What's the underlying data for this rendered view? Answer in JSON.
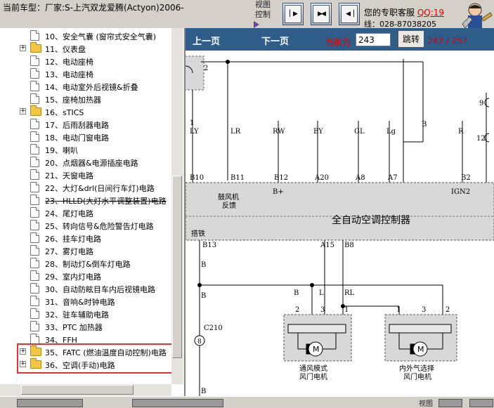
{
  "window": {
    "title": "当前车型：厂家:S-上汽双龙爱腾(Actyon)2006-",
    "view_label": "视图控制",
    "support_text": "您的专职客服",
    "support_qq": "QQ:19",
    "support_line": "线：028-87038205"
  },
  "tree": {
    "items": [
      {
        "label": "10、安全气囊 (窗帘式安全气囊)",
        "type": "doc"
      },
      {
        "label": "11、仪表盘",
        "type": "folder",
        "expandable": true
      },
      {
        "label": "12、电动座椅",
        "type": "doc"
      },
      {
        "label": "13、电动座椅",
        "type": "doc"
      },
      {
        "label": "14、电动室外后视镜&折叠",
        "type": "doc"
      },
      {
        "label": "15、座椅加热器",
        "type": "doc"
      },
      {
        "label": "16、sTICS",
        "type": "folder",
        "expandable": true
      },
      {
        "label": "17、后雨刮器电路",
        "type": "doc"
      },
      {
        "label": "18、电动门窗电路",
        "type": "doc"
      },
      {
        "label": "19、喇叭",
        "type": "doc"
      },
      {
        "label": "20、点烟器&电源插座电路",
        "type": "doc"
      },
      {
        "label": "21、天窗电路",
        "type": "doc"
      },
      {
        "label": "22、大灯&drl(日间行车灯)电路",
        "type": "doc"
      },
      {
        "label": "23、HLLD(大灯水平调整装置)电路",
        "type": "doc",
        "strike": true
      },
      {
        "label": "24、尾灯电路",
        "type": "doc"
      },
      {
        "label": "25、转向信号&危险警告灯电路",
        "type": "doc"
      },
      {
        "label": "26、挂车灯电路",
        "type": "doc"
      },
      {
        "label": "27、雾灯电路",
        "type": "doc"
      },
      {
        "label": "28、制动灯&倒车灯电路",
        "type": "doc"
      },
      {
        "label": "29、室内灯电路",
        "type": "doc"
      },
      {
        "label": "30、自动防眩目车内后视镜电路",
        "type": "doc"
      },
      {
        "label": "31、音响&时钟电路",
        "type": "doc"
      },
      {
        "label": "32、驻车辅助电路",
        "type": "doc"
      },
      {
        "label": "33、PTC 加热器",
        "type": "doc"
      },
      {
        "label": "34、FFH",
        "type": "doc"
      },
      {
        "label": "35、FATC (燃油温度自动控制)电路",
        "type": "folder",
        "expandable": true
      },
      {
        "label": "36、空调(手动)电路",
        "type": "folder",
        "expandable": true
      }
    ]
  },
  "toolbar": {
    "prev_label": "上一页",
    "next_label": "下一页",
    "current_label": "当前为",
    "page_value": "243",
    "jump_label": "跳转",
    "page_count": "243 / 257"
  },
  "diagram": {
    "pin_labels": [
      "LY",
      "LR",
      "RW",
      "BY",
      "GL",
      "Lg",
      "R",
      "B"
    ],
    "pin_names": [
      "B10",
      "B11",
      "B12",
      "A20",
      "A8",
      "A7",
      "B2",
      "IGN2"
    ],
    "b_plus": "B+",
    "blower_feedback_1": "鼓风机",
    "blower_feedback_2": "反馈",
    "controller_label": "全自动空调控制器",
    "ground_label": "搭铁",
    "lower_pins": [
      "B13",
      "A15",
      "B8"
    ],
    "wire_B": "B",
    "wire_L": "L",
    "wire_RL": "RL",
    "motor_pins_left": [
      "2",
      "3",
      "1"
    ],
    "motor_pins_right": [
      "1",
      "3",
      "2"
    ],
    "motor_symbol": "M",
    "connector": "C210",
    "connector_pin": "8",
    "motor1_line1": "通风模式",
    "motor1_line2": "风门电机",
    "motor2_line1": "内外气选择",
    "motor2_line2": "风门电机",
    "top_pin_2": "2",
    "top_pin_1": "1",
    "right_pin_9": "9",
    "right_pin_12": "12"
  },
  "bottombar": {
    "label": "视图"
  },
  "colors": {
    "toolbar_bg": "#2f5d8a",
    "accent_red": "#e00000",
    "highlight_border": "#e53030"
  }
}
